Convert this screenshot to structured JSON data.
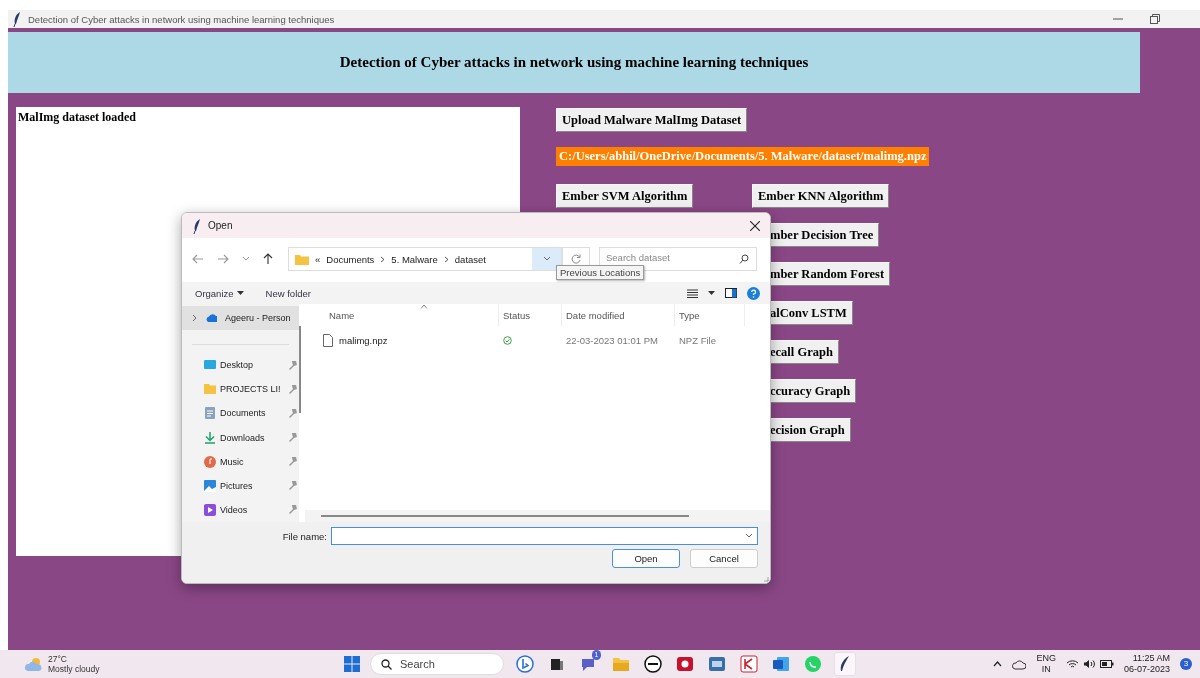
{
  "window": {
    "title": "Detection of Cyber attacks in network using machine learning techniques"
  },
  "header": {
    "title": "Detection of Cyber attacks in network using machine learning techniques"
  },
  "log": {
    "text": "MalImg dataset loaded"
  },
  "upload_button": {
    "label": "Upload Malware MalImg Dataset"
  },
  "path_label": {
    "text": "C:/Users/abhil/OneDrive/Documents/5. Malware/dataset/malimg.npz"
  },
  "algorithm_buttons": [
    {
      "label": "Ember SVM Algorithm",
      "clipped": false
    },
    {
      "label": "Ember KNN Algorithm",
      "clipped": false
    },
    {
      "label": "mber Decision Tree",
      "clipped": true
    },
    {
      "label": "mber Random Forest",
      "clipped": true
    },
    {
      "label": "alConv LSTM",
      "clipped": true
    },
    {
      "label": "ecall Graph",
      "clipped": true
    },
    {
      "label": "ccuracy Graph",
      "clipped": true
    },
    {
      "label": "ecision Graph",
      "clipped": true
    }
  ],
  "dialog": {
    "title": "Open",
    "address": {
      "overflow": "«",
      "segments": [
        "Documents",
        "5. Malware",
        "dataset"
      ]
    },
    "search": {
      "placeholder": "Search dataset"
    },
    "tooltip": "Previous Locations",
    "toolbar": {
      "organize": "Organize",
      "new_folder": "New folder"
    },
    "sidebar": [
      {
        "label": "Ageeru - Person",
        "kind": "cloud",
        "selected": true,
        "pinned": false
      },
      {
        "label": "Desktop",
        "kind": "desktop",
        "selected": false,
        "pinned": true
      },
      {
        "label": "PROJECTS LI!",
        "kind": "folder",
        "selected": false,
        "pinned": true
      },
      {
        "label": "Documents",
        "kind": "documents",
        "selected": false,
        "pinned": true
      },
      {
        "label": "Downloads",
        "kind": "downloads",
        "selected": false,
        "pinned": true
      },
      {
        "label": "Music",
        "kind": "music",
        "selected": false,
        "pinned": true
      },
      {
        "label": "Pictures",
        "kind": "pictures",
        "selected": false,
        "pinned": true
      },
      {
        "label": "Videos",
        "kind": "videos",
        "selected": false,
        "pinned": true
      }
    ],
    "columns": [
      "Name",
      "Status",
      "Date modified",
      "Type"
    ],
    "files": [
      {
        "name": "malimg.npz",
        "date_modified": "22-03-2023 01:01 PM",
        "type": "NPZ File"
      }
    ],
    "file_name": {
      "label": "File name:"
    },
    "buttons": [
      {
        "label": "Open",
        "kind": "default"
      },
      {
        "label": "Cancel",
        "kind": "normal"
      }
    ]
  },
  "taskbar": {
    "weather": {
      "temperature": "27°C",
      "condition": "Mostly cloudy"
    },
    "search": {
      "placeholder": "Search"
    },
    "apps": [
      {
        "kind": "bing",
        "active": false
      },
      {
        "kind": "taskview",
        "active": false
      },
      {
        "kind": "chat",
        "active": false,
        "badge": "1"
      },
      {
        "kind": "files",
        "active": false
      },
      {
        "kind": "dell",
        "active": false
      },
      {
        "kind": "recorder",
        "active": false
      },
      {
        "kind": "sas",
        "active": false
      },
      {
        "kind": "ks",
        "active": false
      },
      {
        "kind": "word",
        "active": false
      },
      {
        "kind": "whatsapp",
        "active": false
      },
      {
        "kind": "feather",
        "active": true
      }
    ],
    "language": {
      "top": "ENG",
      "bottom": "IN"
    },
    "time": "11:25 AM",
    "date": "06-07-2023",
    "notifications": "3"
  }
}
